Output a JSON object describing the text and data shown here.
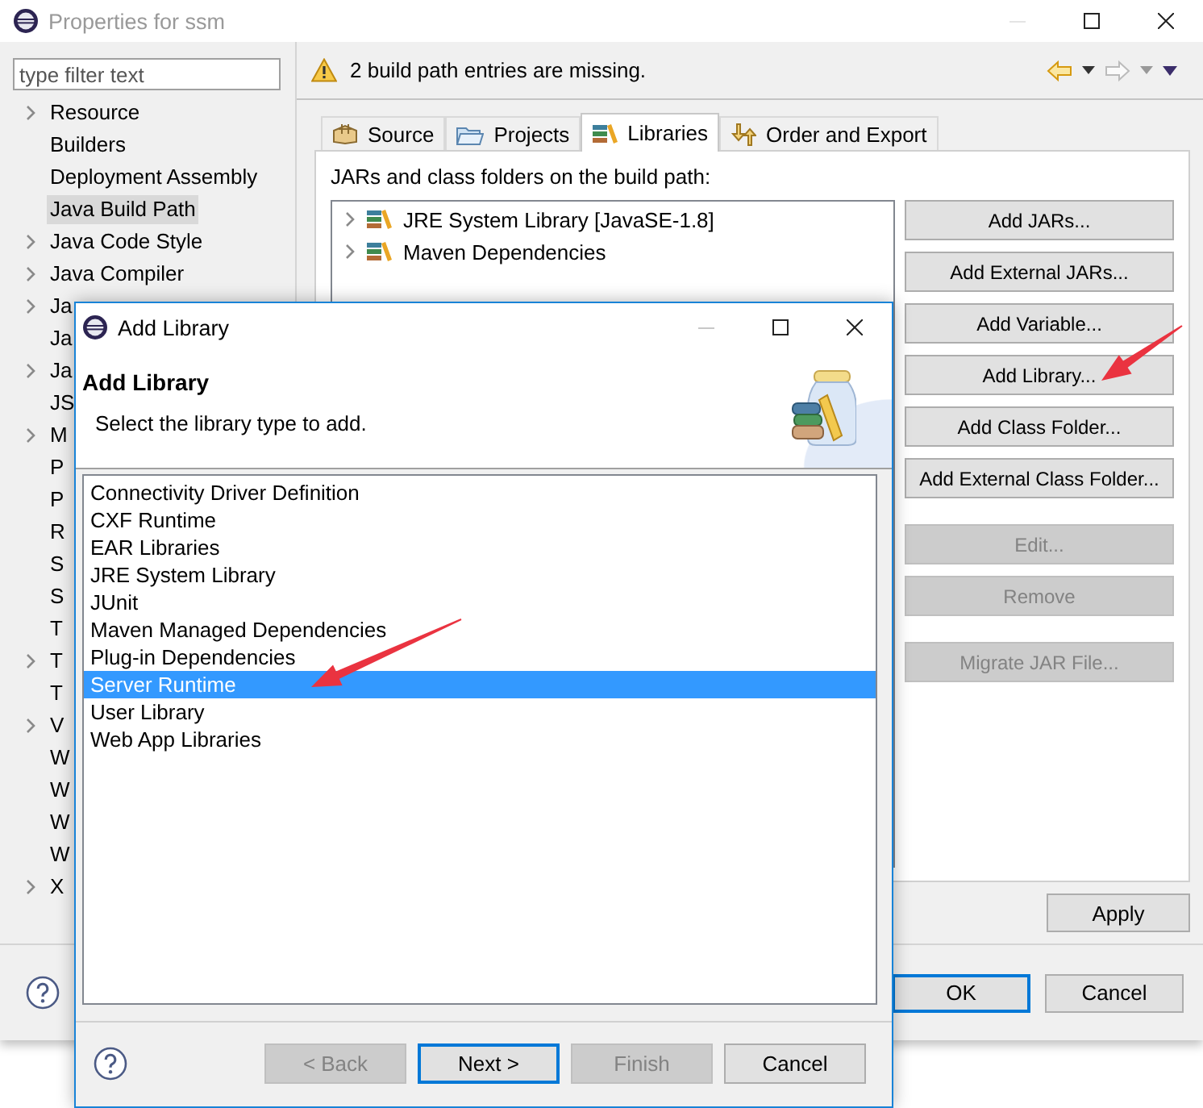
{
  "window": {
    "title": "Properties for ssm"
  },
  "filter": {
    "placeholder": "type filter text"
  },
  "nav_tree": [
    {
      "label": "Resource",
      "expandable": true,
      "selected": false
    },
    {
      "label": "Builders",
      "expandable": false,
      "selected": false
    },
    {
      "label": "Deployment Assembly",
      "expandable": false,
      "selected": false
    },
    {
      "label": "Java Build Path",
      "expandable": false,
      "selected": true
    },
    {
      "label": "Java Code Style",
      "expandable": true,
      "selected": false
    },
    {
      "label": "Java Compiler",
      "expandable": true,
      "selected": false
    },
    {
      "label": "Ja",
      "expandable": true,
      "selected": false
    },
    {
      "label": "Ja",
      "expandable": false,
      "selected": false
    },
    {
      "label": "Ja",
      "expandable": true,
      "selected": false
    },
    {
      "label": "JS",
      "expandable": false,
      "selected": false
    },
    {
      "label": "M",
      "expandable": true,
      "selected": false
    },
    {
      "label": "P",
      "expandable": false,
      "selected": false
    },
    {
      "label": "P",
      "expandable": false,
      "selected": false
    },
    {
      "label": "R",
      "expandable": false,
      "selected": false
    },
    {
      "label": "S",
      "expandable": false,
      "selected": false
    },
    {
      "label": "S",
      "expandable": false,
      "selected": false
    },
    {
      "label": "T",
      "expandable": false,
      "selected": false
    },
    {
      "label": "T",
      "expandable": true,
      "selected": false
    },
    {
      "label": "T",
      "expandable": false,
      "selected": false
    },
    {
      "label": "V",
      "expandable": true,
      "selected": false
    },
    {
      "label": "W",
      "expandable": false,
      "selected": false
    },
    {
      "label": "W",
      "expandable": false,
      "selected": false
    },
    {
      "label": "W",
      "expandable": false,
      "selected": false
    },
    {
      "label": "W",
      "expandable": false,
      "selected": false
    },
    {
      "label": "X",
      "expandable": true,
      "selected": false
    }
  ],
  "message": {
    "text": "2 build path entries are missing."
  },
  "tabs": [
    {
      "label": "Source",
      "selected": false
    },
    {
      "label": "Projects",
      "selected": false
    },
    {
      "label": "Libraries",
      "selected": true
    },
    {
      "label": "Order and Export",
      "selected": false
    }
  ],
  "build_path_label": "JARs and class folders on the build path:",
  "libraries": [
    {
      "label": "JRE System Library [JavaSE-1.8]"
    },
    {
      "label": "Maven Dependencies"
    }
  ],
  "button_groups": [
    {
      "buttons": [
        {
          "label": "Add JARs...",
          "disabled": false
        },
        {
          "label": "Add External JARs...",
          "disabled": false
        },
        {
          "label": "Add Variable...",
          "disabled": false
        },
        {
          "label": "Add Library...",
          "disabled": false
        },
        {
          "label": "Add Class Folder...",
          "disabled": false
        },
        {
          "label": "Add External Class Folder...",
          "disabled": false
        }
      ]
    },
    {
      "buttons": [
        {
          "label": "Edit...",
          "disabled": true
        },
        {
          "label": "Remove",
          "disabled": true
        }
      ]
    },
    {
      "buttons": [
        {
          "label": "Migrate JAR File...",
          "disabled": true
        }
      ]
    }
  ],
  "apply_button": {
    "label": "Apply"
  },
  "footer_buttons": [
    {
      "label": "OK",
      "default": true
    },
    {
      "label": "Cancel",
      "default": false
    }
  ],
  "dialog": {
    "title": "Add Library",
    "heading": "Add Library",
    "description": "Select the library type to add.",
    "library_types": [
      {
        "label": "Connectivity Driver Definition",
        "selected": false
      },
      {
        "label": "CXF Runtime",
        "selected": false
      },
      {
        "label": "EAR Libraries",
        "selected": false
      },
      {
        "label": "JRE System Library",
        "selected": false
      },
      {
        "label": "JUnit",
        "selected": false
      },
      {
        "label": "Maven Managed Dependencies",
        "selected": false
      },
      {
        "label": "Plug-in Dependencies",
        "selected": false
      },
      {
        "label": "Server Runtime",
        "selected": true
      },
      {
        "label": "User Library",
        "selected": false
      },
      {
        "label": "Web App Libraries",
        "selected": false
      }
    ],
    "buttons": [
      {
        "label": "< Back",
        "disabled": true,
        "default": false
      },
      {
        "label": "Next >",
        "disabled": false,
        "default": true
      },
      {
        "label": "Finish",
        "disabled": true,
        "default": false
      },
      {
        "label": "Cancel",
        "disabled": false,
        "default": false
      }
    ]
  }
}
